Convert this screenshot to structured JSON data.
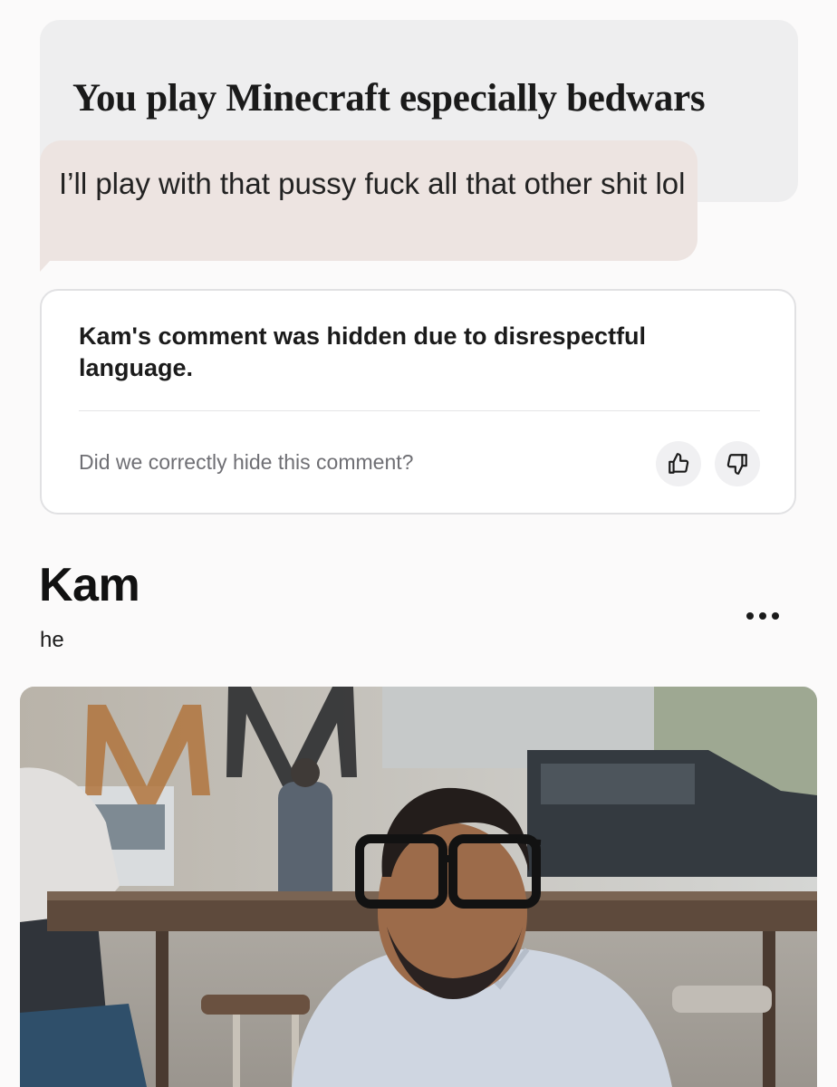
{
  "prompt": {
    "text": "You play Minecraft especially bedwars"
  },
  "reply": {
    "text": "I’ll play with that pussy fuck all that other shit lol"
  },
  "notice": {
    "title": "Kam's comment was hidden due to disrespectful language.",
    "question": "Did we correctly hide this comment?",
    "thumbs_up_icon": "thumbs-up-icon",
    "thumbs_down_icon": "thumbs-down-icon"
  },
  "profile": {
    "name": "Kam",
    "pronoun": "he",
    "more_icon": "more-horizontal-icon"
  },
  "colors": {
    "prompt_card": "#eeeeef",
    "reply_bubble": "#ede4e1",
    "notice_border": "#e1e1e3"
  }
}
